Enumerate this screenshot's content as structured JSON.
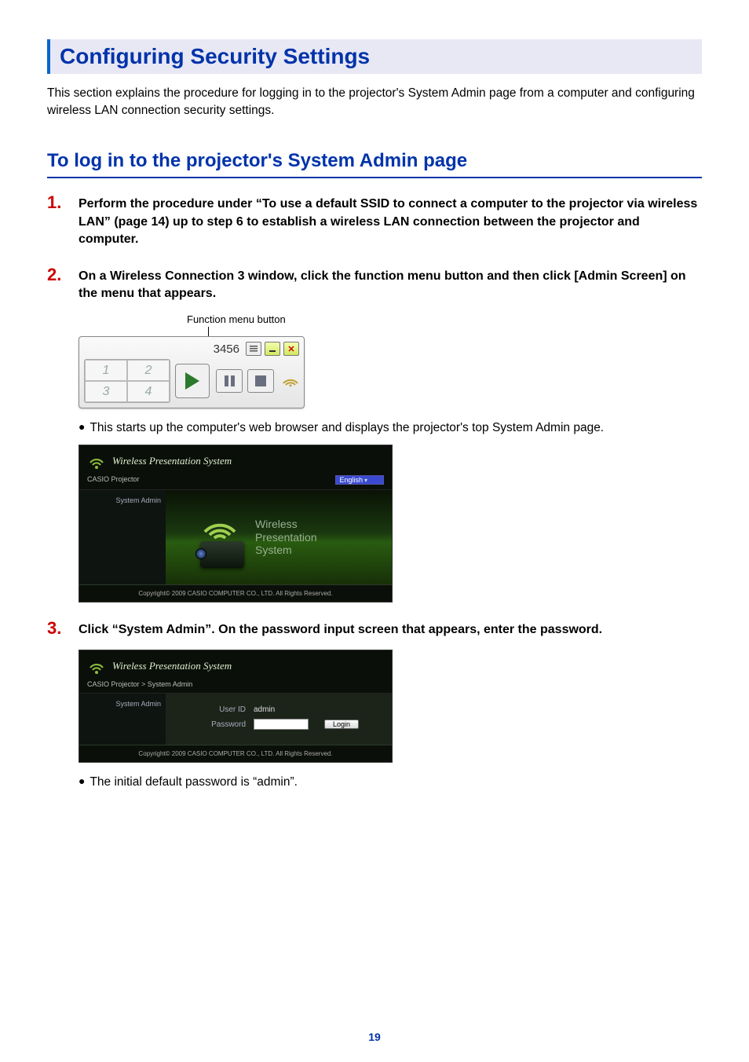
{
  "heading": "Configuring Security Settings",
  "intro": "This section explains the procedure for logging in to the projector's System Admin page from a computer and configuring wireless LAN connection security settings.",
  "subheading": "To log in to the projector's System Admin page",
  "steps": {
    "s1": {
      "num": "1.",
      "text": "Perform the procedure under “To use a default SSID to connect a computer to the projector via wireless LAN” (page 14) up to step 6 to establish a wireless LAN connection between the projector and computer."
    },
    "s2": {
      "num": "2.",
      "text": "On a Wireless Connection 3 window, click the function menu button and then click [Admin Screen] on the menu that appears."
    },
    "s3": {
      "num": "3.",
      "text": "Click “System Admin”. On the password input screen that appears, enter the password."
    }
  },
  "annot_fn_menu": "Function menu button",
  "wc3": {
    "number": "3456",
    "quads": [
      "1",
      "2",
      "3",
      "4"
    ]
  },
  "bullet_after2": "This starts up the computer's web browser and displays the projector's top System Admin page.",
  "bullet_after3": "The initial default password is “admin”.",
  "sa": {
    "title": "Wireless Presentation System",
    "crumb1": "CASIO Projector",
    "crumb2": "CASIO Projector > System Admin",
    "lang": "English",
    "side_item": "System Admin",
    "wp_line1": "Wireless",
    "wp_line2": "Presentation",
    "wp_line3": "System",
    "copyright": "Copyright© 2009 CASIO COMPUTER CO., LTD. All Rights Reserved.",
    "user_label": "User ID",
    "user_value": "admin",
    "pass_label": "Password",
    "login_btn": "Login"
  },
  "page_number": "19"
}
